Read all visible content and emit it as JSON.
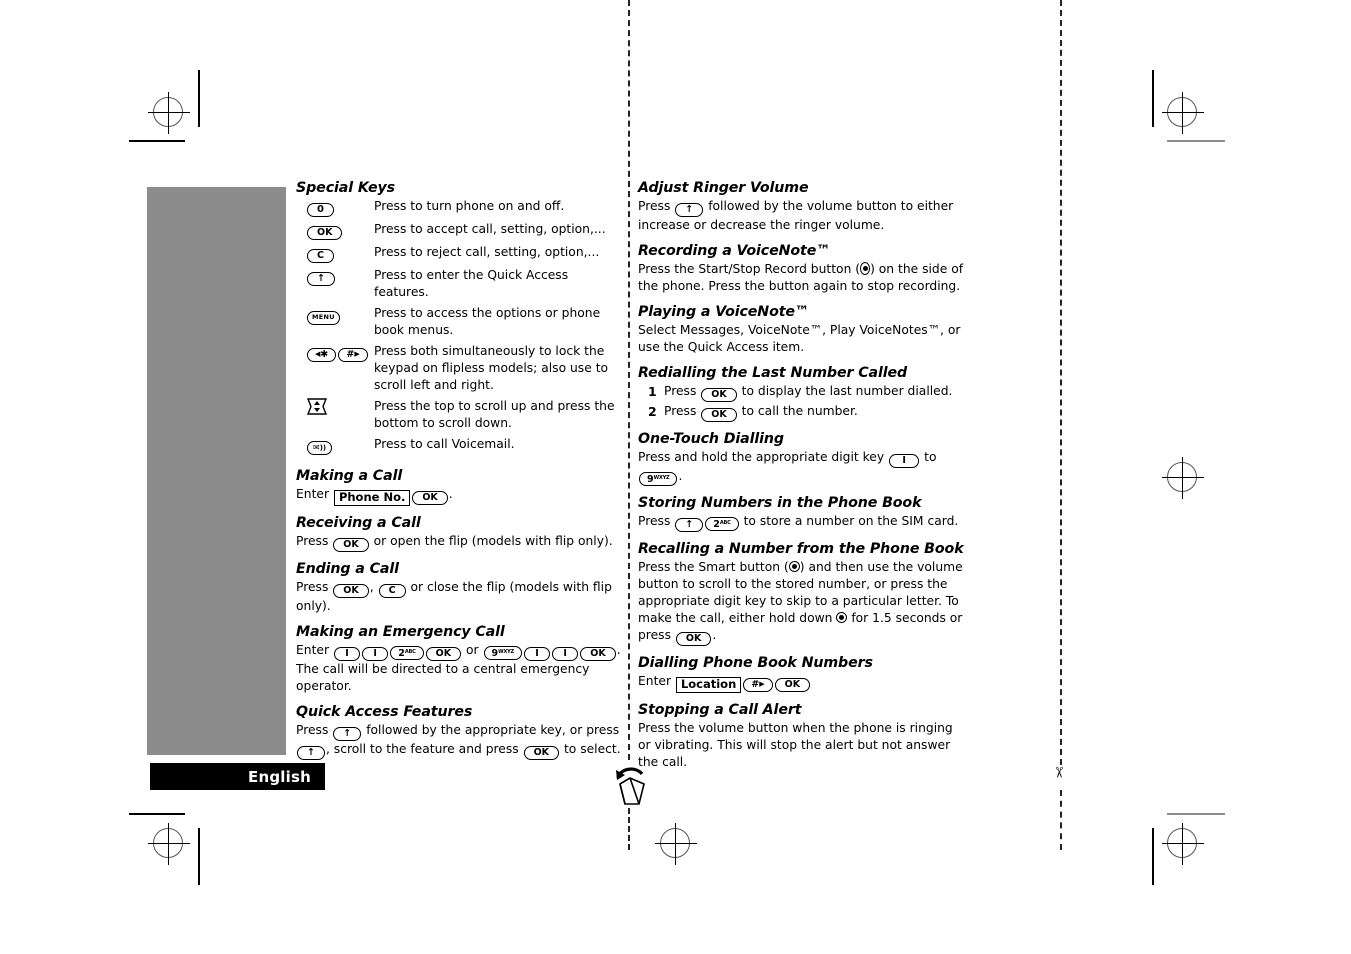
{
  "page": {
    "language_label": "English"
  },
  "left_column": {
    "special_keys": {
      "heading": "Special Keys",
      "rows": [
        {
          "key": "power",
          "key_label": "0",
          "description": "Press to turn phone on and off."
        },
        {
          "key": "ok",
          "key_label": "OK",
          "description": "Press to accept call, setting, option,..."
        },
        {
          "key": "c",
          "key_label": "C",
          "description": "Press to reject call, setting, option,..."
        },
        {
          "key": "up-arrow",
          "key_label": "↑",
          "description": "Press to enter the Quick Access features."
        },
        {
          "key": "menu",
          "key_label": "MENU",
          "description": "Press to access the options or phone book menus."
        },
        {
          "key": "star-hash",
          "key_label": "◄* #►",
          "description": "Press both simultaneously to lock the keypad on flipless models; also use to scroll left and right."
        },
        {
          "key": "rocker",
          "key_label": "",
          "description": "Press the top to scroll up and press the bottom to scroll down."
        },
        {
          "key": "voicemail",
          "key_label": "✉",
          "description": "Press to call Voicemail."
        }
      ]
    },
    "making_a_call": {
      "heading": "Making a Call",
      "text_before": "Enter",
      "field": "Phone No.",
      "key_ok": "OK",
      "text_after": "."
    },
    "receiving_a_call": {
      "heading": "Receiving a Call",
      "text_before": "Press",
      "key_ok": "OK",
      "text_after": "or open the flip (models with flip only)."
    },
    "ending_a_call": {
      "heading": "Ending a Call",
      "text_before": "Press",
      "key_ok": "OK",
      "text_mid": ",",
      "key_c": "C",
      "text_after": "or close the flip (models with flip only)."
    },
    "emergency_call": {
      "heading": "Making an Emergency Call",
      "text_before": "Enter",
      "keys_first": [
        "1",
        "1",
        "2",
        "OK"
      ],
      "text_or": "or",
      "keys_second": [
        "9",
        "1",
        "1",
        "OK"
      ],
      "text_after": ". The call will be directed to a central emergency operator."
    },
    "quick_access": {
      "heading": "Quick Access Features",
      "text_1": "Press",
      "key_up": "↑",
      "text_2": "followed by the appropriate key, or press",
      "text_3": ", scroll to the feature and press",
      "key_ok": "OK",
      "text_4": "to select."
    }
  },
  "right_column": {
    "adjust_ringer_volume": {
      "heading": "Adjust Ringer Volume",
      "text_before": "Press",
      "key_up": "↑",
      "text_after": "followed by the volume button to either increase or decrease the ringer volume."
    },
    "recording_voicenote": {
      "heading": "Recording a VoiceNote™",
      "text_before": "Press the Start/Stop Record button (",
      "text_after": ") on the side of the phone. Press the button again to stop recording."
    },
    "playing_voicenote": {
      "heading": "Playing a VoiceNote™",
      "text": "Select Messages, VoiceNote™, Play VoiceNotes™, or use the Quick Access item."
    },
    "redialling": {
      "heading": "Redialling the Last Number Called",
      "steps": [
        {
          "num": "1",
          "text_before": "Press",
          "key_ok": "OK",
          "text_after": "to display the last number dialled."
        },
        {
          "num": "2",
          "text_before": "Press",
          "key_ok": "OK",
          "text_after": "to call the number."
        }
      ]
    },
    "one_touch_dialling": {
      "heading": "One-Touch Dialling",
      "text_before": "Press and hold the appropriate digit key",
      "key_1": "1",
      "text_mid": "to",
      "key_9": "9",
      "text_after": "."
    },
    "storing_numbers": {
      "heading": "Storing Numbers in the Phone Book",
      "text_before": "Press",
      "key_up": "↑",
      "key_2": "2",
      "text_after": "to store a number on the SIM card."
    },
    "recalling_number": {
      "heading": "Recalling a Number from the Phone Book",
      "text_1": "Press the Smart button (",
      "text_2": ") and then use the volume button to scroll to the stored number, or press the appropriate digit key to skip to a particular letter. To make the call, either hold down",
      "text_3": "for 1.5 seconds or press",
      "key_ok": "OK",
      "text_4": "."
    },
    "dialling_phone_book": {
      "heading": "Dialling Phone Book Numbers",
      "text_before": "Enter",
      "field": "Location",
      "key_hash": "#►",
      "key_ok": "OK"
    },
    "stopping_call_alert": {
      "heading": "Stopping a Call Alert",
      "text": "Press the volume button when the phone is ringing or vibrating. This will stop the alert but not answer the call."
    }
  },
  "print_marks": {
    "fold_icon": "fold-arrow-icon",
    "cut_icon": "scissors-icon"
  },
  "colors": {
    "gray_panel": "#8c8c8c",
    "lang_bar": "#000000",
    "text": "#000000"
  }
}
